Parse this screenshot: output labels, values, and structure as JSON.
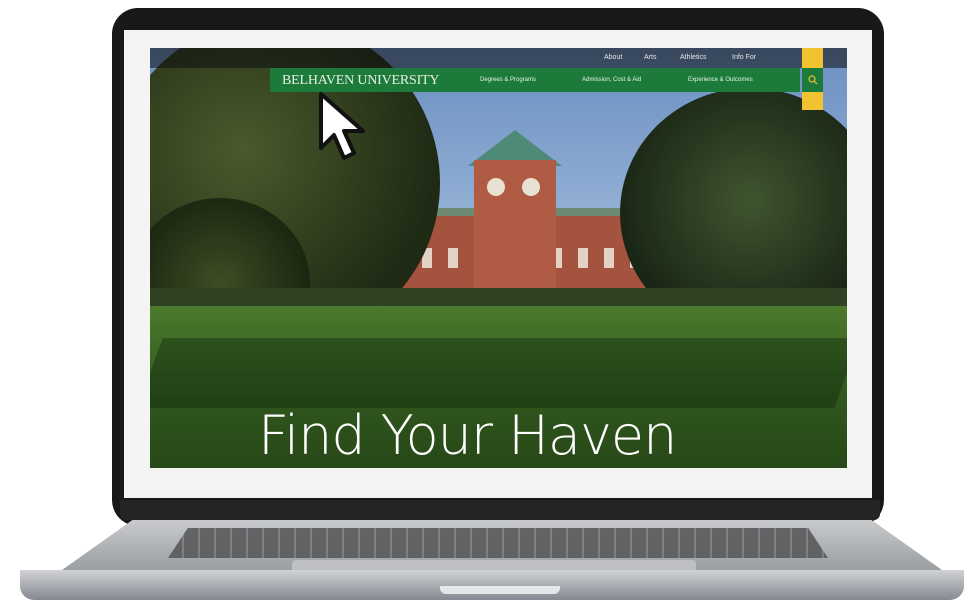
{
  "site": {
    "logo_text": "BELHAVEN UNIVERSITY",
    "utility_nav": [
      "About",
      "Arts",
      "Athletics",
      "Info For"
    ],
    "main_nav": [
      "Degrees & Programs",
      "Admission, Cost & Aid",
      "Experience & Outcomes"
    ],
    "headline": "Find Your Haven"
  },
  "colors": {
    "nav_green": "#1c7a3a",
    "accent_yellow": "#f2c331",
    "laptop_bezel": "#17181a",
    "headline_text": "#ffffff"
  },
  "icons": {
    "search": "search-icon",
    "cursor": "mouse-pointer-icon"
  }
}
